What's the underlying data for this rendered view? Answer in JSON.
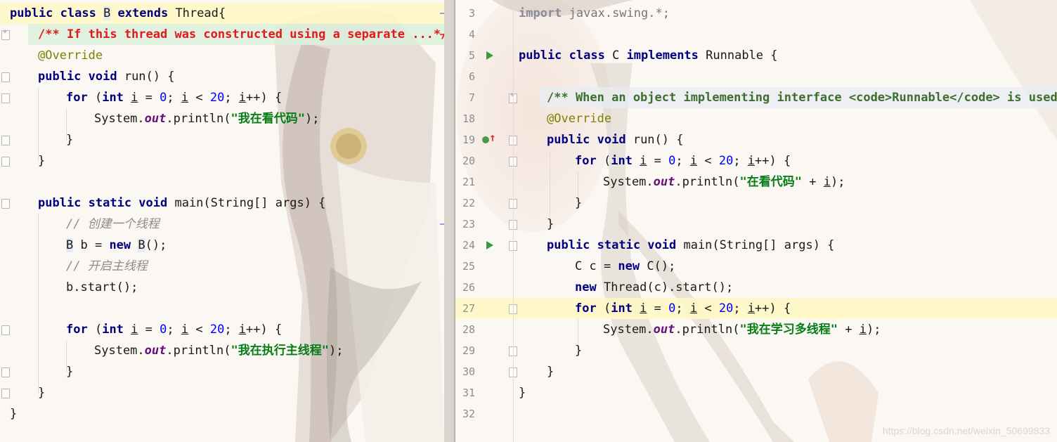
{
  "left": {
    "lines": [
      "public class B extends Thread{",
      "/** If this thread was constructed using a separate ...*/",
      "@Override",
      "public void run() {",
      "for (int i = 0; i < 20; i++) {",
      "System.out.println(\"我在看代码\");",
      "}",
      "}",
      "",
      "public static void main(String[] args) {",
      "// 创建一个线程",
      "B b = new B();",
      "// 开启主线程",
      "b.start();",
      "",
      "for (int i = 0; i < 20; i++) {",
      "System.out.println(\"我在执行主线程\");",
      "}",
      "}",
      "}"
    ]
  },
  "right": {
    "line_numbers": [
      "3",
      "4",
      "5",
      "6",
      "7",
      "18",
      "19",
      "20",
      "21",
      "22",
      "23",
      "24",
      "25",
      "26",
      "27",
      "28",
      "29",
      "30",
      "31",
      "32"
    ],
    "lines": [
      "import javax.swing.*;",
      "",
      "public class C implements Runnable {",
      "",
      "/** When an object implementing interface <code>Runnable</code> is used ...",
      "@Override",
      "public void run() {",
      "for (int i = 0; i < 20; i++) {",
      "System.out.println(\"在看代码\" + i);",
      "}",
      "}",
      "public static void main(String[] args) {",
      "C c = new C();",
      "new Thread(c).start();",
      "for (int i = 0; i < 20; i++) {",
      "System.out.println(\"我在学习多线程\" + i);",
      "}",
      "}",
      "}",
      ""
    ]
  },
  "watermark": "https://blog.csdn.net/weixin_50699833",
  "colors": {
    "keyword": "#000080",
    "string": "#067d17",
    "number": "#0000ff",
    "annotation": "#808000",
    "field": "#660e7a"
  }
}
